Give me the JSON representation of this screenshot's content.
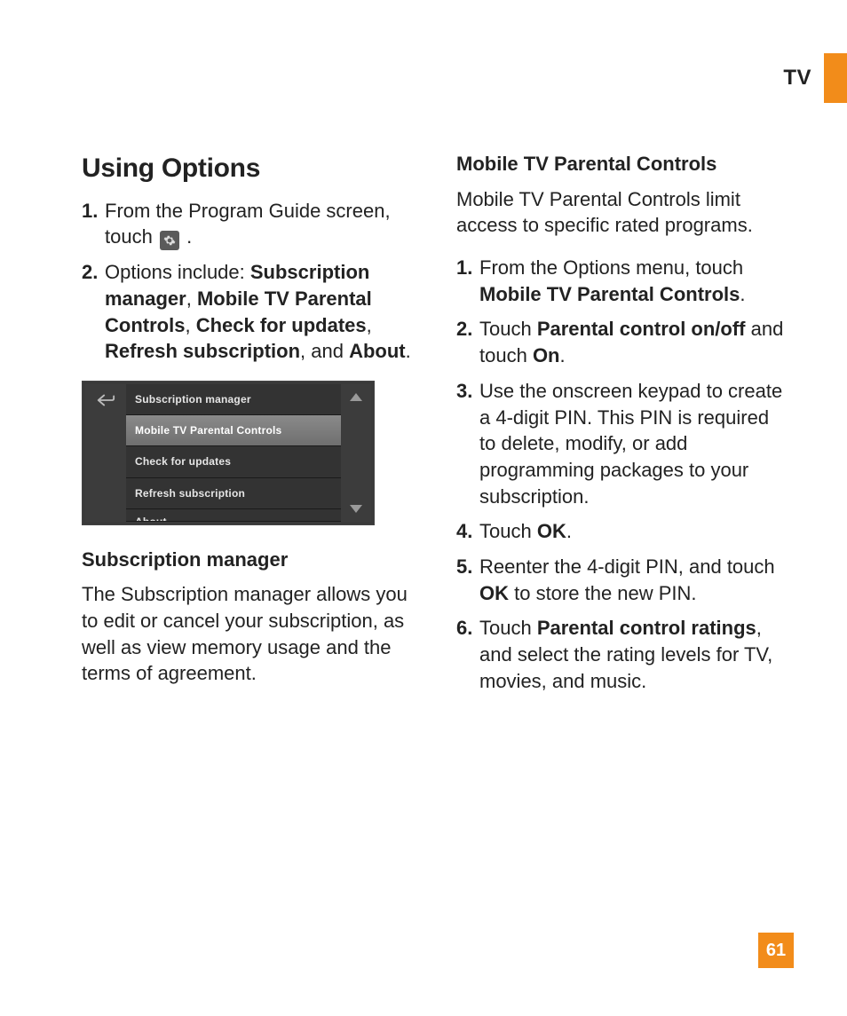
{
  "header": {
    "section": "TV"
  },
  "page_number": "61",
  "left": {
    "heading": "Using Options",
    "step1_prefix": "From the Program Guide screen, touch ",
    "step1_suffix": " .",
    "step2_prefix": "Options include: ",
    "step2_b1": "Subscription manager",
    "step2_c1": ", ",
    "step2_b2": "Mobile TV Parental Controls",
    "step2_c2": ", ",
    "step2_b3": "Check for updates",
    "step2_c3": ", ",
    "step2_b4": "Refresh subscription",
    "step2_c4": ", and ",
    "step2_b5": "About",
    "step2_c5": ".",
    "nums": {
      "n1": "1.",
      "n2": "2."
    },
    "screenshot": {
      "items": [
        "Subscription manager",
        "Mobile TV Parental Controls",
        "Check for updates",
        "Refresh subscription",
        "About"
      ],
      "selected_index": 1
    },
    "sub_heading": "Subscription manager",
    "sub_para": "The Subscription manager allows you to edit or cancel your subscription, as well as view memory usage and the terms of agreement."
  },
  "right": {
    "heading": "Mobile TV Parental Controls",
    "intro": "Mobile TV Parental Controls limit access to specific rated programs.",
    "nums": {
      "n1": "1.",
      "n2": "2.",
      "n3": "3.",
      "n4": "4.",
      "n5": "5.",
      "n6": "6."
    },
    "s1_a": "From the Options menu, touch ",
    "s1_b": "Mobile TV Parental Controls",
    "s1_c": ".",
    "s2_a": "Touch ",
    "s2_b": "Parental control on/off",
    "s2_c": " and touch ",
    "s2_d": "On",
    "s2_e": ".",
    "s3": "Use the onscreen keypad to create a 4-digit PIN. This PIN is required to delete, modify, or add programming packages to your subscription.",
    "s4_a": "Touch ",
    "s4_b": "OK",
    "s4_c": ".",
    "s5_a": "Reenter the 4-digit PIN, and touch ",
    "s5_b": "OK",
    "s5_c": " to store the new PIN.",
    "s6_a": "Touch ",
    "s6_b": "Parental control ratings",
    "s6_c": ", and select the rating levels for TV, movies, and music."
  }
}
